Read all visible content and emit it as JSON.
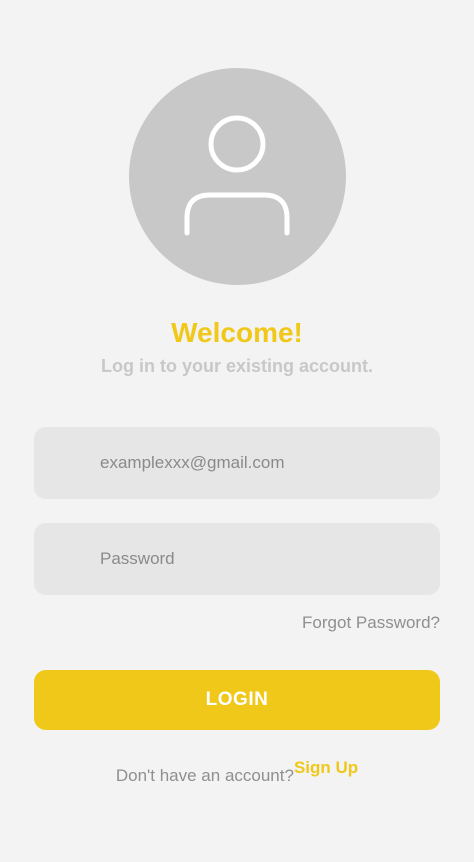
{
  "header": {
    "title": "Welcome!",
    "subtitle": "Log in to your existing account."
  },
  "avatar": {
    "icon": "user-icon"
  },
  "form": {
    "email_placeholder": "examplexxx@gmail.com",
    "password_placeholder": "Password",
    "forgot_password": "Forgot Password?",
    "login_label": "LOGIN"
  },
  "footer": {
    "prompt": "Don't have an account?",
    "signup_label": "Sign Up"
  },
  "colors": {
    "accent": "#f0c81a",
    "background": "#f3f3f3",
    "field": "#e6e6e6",
    "avatar": "#c8c8c8"
  }
}
